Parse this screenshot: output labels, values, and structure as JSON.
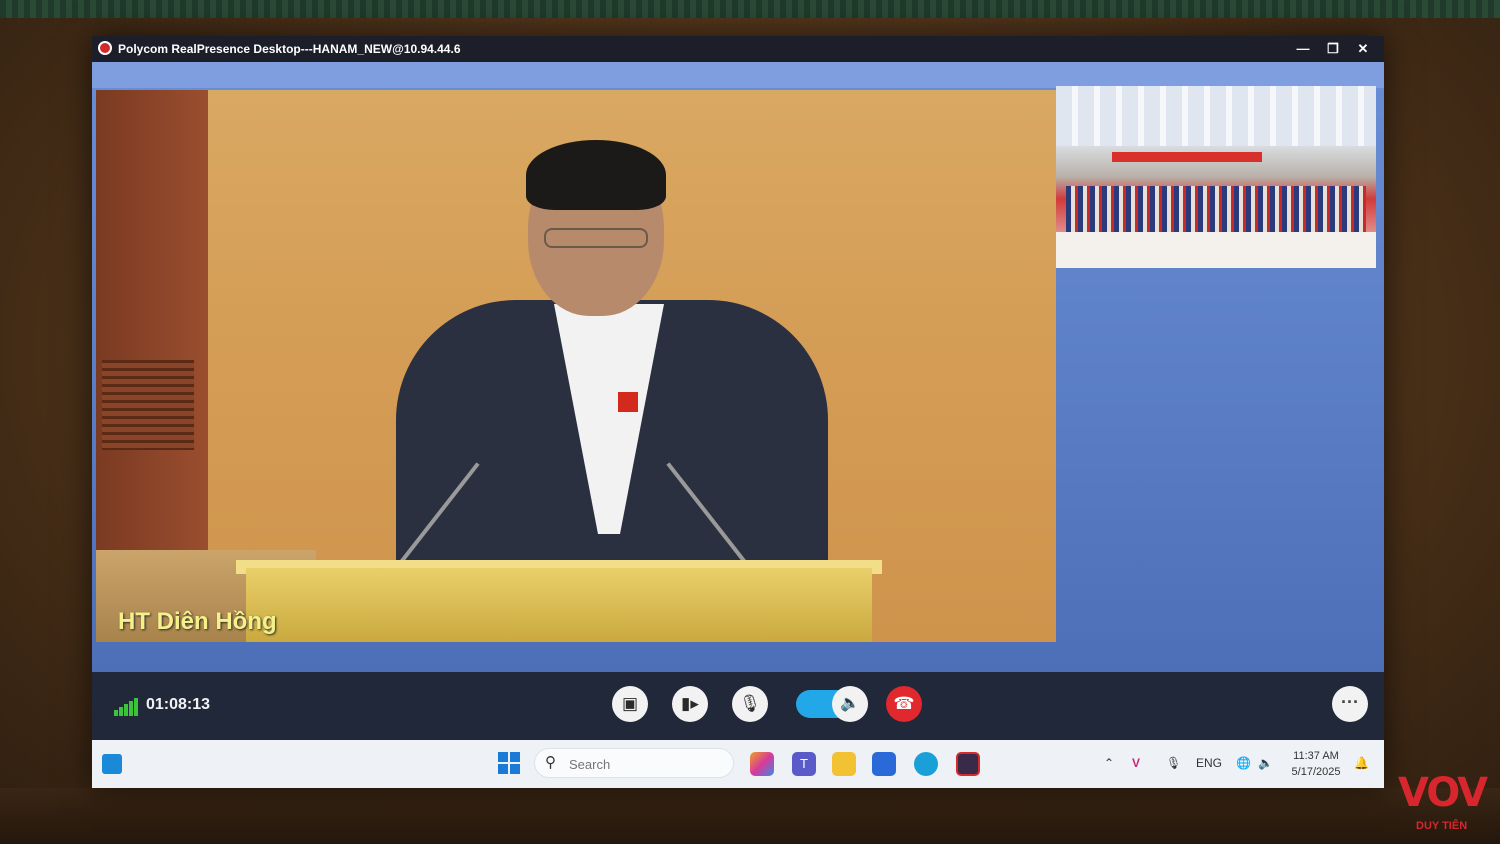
{
  "window": {
    "title": "Polycom RealPresence Desktop---HANAM_NEW@10.94.44.6",
    "minimize_icon": "minimize-icon",
    "restore_icon": "restore-icon",
    "close_icon": "close-icon"
  },
  "main_video": {
    "caption": "HT Diên Hồng"
  },
  "call_bar": {
    "duration": "01:08:13",
    "signal_icon": "signal-bars-icon",
    "buttons": [
      {
        "name": "content-share-button",
        "icon": "share-icon"
      },
      {
        "name": "camera-button",
        "icon": "camera-icon"
      },
      {
        "name": "microphone-button",
        "icon": "microphone-icon"
      },
      {
        "name": "speaker-toggle",
        "icon": "speaker-icon",
        "state": "on"
      },
      {
        "name": "hang-up-button",
        "icon": "hang-up-icon"
      },
      {
        "name": "more-options-button",
        "icon": "ellipsis-icon"
      }
    ],
    "colors": {
      "toggle_on": "#22a8e8",
      "hang_up": "#e0282e",
      "signal": "#3ac43a"
    }
  },
  "taskbar": {
    "search_placeholder": "Search",
    "language": "ENG",
    "time": "11:37 AM",
    "date": "5/17/2025",
    "apps": [
      "copilot-app-icon",
      "teams-app-icon",
      "file-explorer-icon",
      "store-app-icon",
      "edge-browser-icon",
      "polycom-app-icon"
    ]
  },
  "watermark": {
    "brand": "VOV",
    "sub": "DUY TIÊN"
  }
}
